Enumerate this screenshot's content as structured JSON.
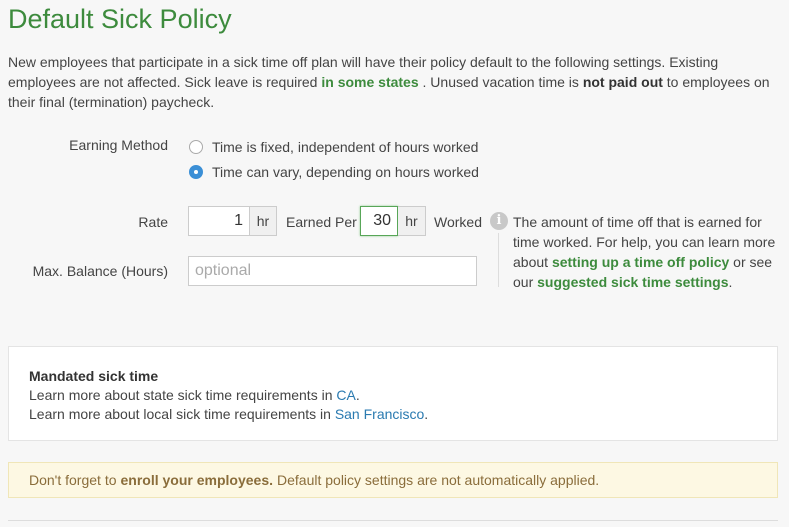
{
  "page_title": "Default Sick Policy",
  "intro": {
    "text1": "New employees that participate in a sick time off plan will have their policy default to the following settings. Existing employees are not affected. Sick leave is required ",
    "link_states": "in some states",
    "text2": " . Unused vacation time is ",
    "bold_not_paid": "not paid out",
    "text3": " to employees on their final (termination) paycheck."
  },
  "earning_method": {
    "label": "Earning Method",
    "options": [
      {
        "label": "Time is fixed, independent of hours worked",
        "selected": false
      },
      {
        "label": "Time can vary, depending on hours worked",
        "selected": true
      }
    ]
  },
  "rate": {
    "label": "Rate",
    "value": "1",
    "unit": "hr",
    "earned_per_label": "Earned Per",
    "per_value": "30",
    "per_unit": "hr",
    "worked_label": "Worked"
  },
  "max_balance": {
    "label": "Max. Balance (Hours)",
    "placeholder": "optional"
  },
  "help": {
    "icon": "info-icon",
    "text1": "The amount of time off that is earned for time worked. For help, you can learn more about ",
    "link1": "setting up a time off policy",
    "text2": " or see our ",
    "link2": "suggested sick time settings",
    "text3": "."
  },
  "mandated": {
    "heading": "Mandated sick time",
    "state_text": "Learn more about state sick time requirements in ",
    "state_link": "CA",
    "state_after": ".",
    "local_text": "Learn more about local sick time requirements in ",
    "local_link": "San Francisco",
    "local_after": "."
  },
  "notice": {
    "text1": "Don't forget to",
    "bold": "enroll your employees.",
    "text2": "Default policy settings are not automatically applied."
  },
  "colors": {
    "brand_green": "#3d8b3d",
    "radio_blue": "#3b8fd6",
    "link_blue": "#2a7ab0",
    "notice_bg": "#fdf8e3"
  }
}
